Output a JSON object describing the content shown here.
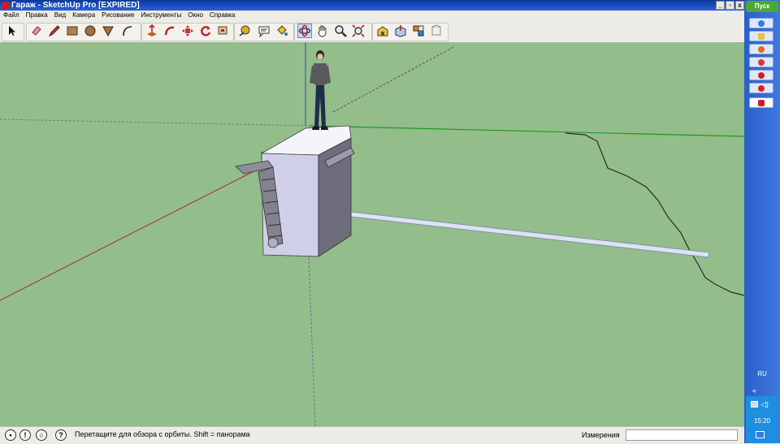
{
  "window": {
    "title": "Гараж - SketchUp Pro [EXPIRED]",
    "minimize_label": "_",
    "maximize_label": "▫",
    "close_label": "x"
  },
  "menu": {
    "items": [
      "Файл",
      "Правка",
      "Вид",
      "Камера",
      "Рисование",
      "Инструменты",
      "Окно",
      "Справка"
    ]
  },
  "toolbar": {
    "tools": [
      {
        "name": "select-tool",
        "icon": "arrow-icon"
      },
      {
        "name": "eraser-tool",
        "icon": "eraser-icon"
      },
      {
        "name": "pencil-tool",
        "icon": "pencil-icon"
      },
      {
        "name": "rectangle-tool",
        "icon": "rectangle-icon"
      },
      {
        "name": "circle-tool",
        "icon": "circle-icon"
      },
      {
        "name": "polygon-tool",
        "icon": "triangle-icon"
      },
      {
        "name": "arc-tool",
        "icon": "arc-icon"
      },
      {
        "name": "push-pull-tool",
        "icon": "push-pull-icon"
      },
      {
        "name": "follow-me-tool",
        "icon": "follow-me-icon"
      },
      {
        "name": "move-tool",
        "icon": "move-icon"
      },
      {
        "name": "rotate-tool",
        "icon": "rotate-icon"
      },
      {
        "name": "offset-tool",
        "icon": "offset-icon"
      },
      {
        "name": "tape-measure-tool",
        "icon": "tape-icon"
      },
      {
        "name": "text-tool",
        "icon": "text-icon"
      },
      {
        "name": "paint-bucket-tool",
        "icon": "paint-bucket-icon"
      },
      {
        "name": "orbit-tool",
        "icon": "orbit-icon",
        "active": true
      },
      {
        "name": "pan-tool",
        "icon": "hand-icon"
      },
      {
        "name": "zoom-tool",
        "icon": "magnifier-icon"
      },
      {
        "name": "zoom-extents-tool",
        "icon": "zoom-extents-icon"
      },
      {
        "name": "warehouse-tool",
        "icon": "warehouse-icon"
      },
      {
        "name": "share-model-tool",
        "icon": "share-icon"
      },
      {
        "name": "components-tool",
        "icon": "components-icon"
      },
      {
        "name": "extension-tool",
        "icon": "extension-icon"
      }
    ]
  },
  "status": {
    "message": "Перетащите для обзора с орбиты.  Shift = панорама",
    "measure_label": "Измерения",
    "measure_value": ""
  },
  "taskbar": {
    "start_label": "Пуск",
    "lang": "RU",
    "chevron": "«",
    "clock": "15:20",
    "apps": [
      {
        "name": "ie-app",
        "color": "#2a7de0"
      },
      {
        "name": "explorer-app",
        "color": "#e8c040"
      },
      {
        "name": "firefox-app",
        "color": "#e86820"
      },
      {
        "name": "chrome-app",
        "color": "#d83a2a"
      },
      {
        "name": "opera-app",
        "color": "#cc1f1f"
      },
      {
        "name": "yandex-app",
        "color": "#e02020"
      },
      {
        "name": "sketchup-app",
        "color": "#c82020"
      }
    ]
  }
}
